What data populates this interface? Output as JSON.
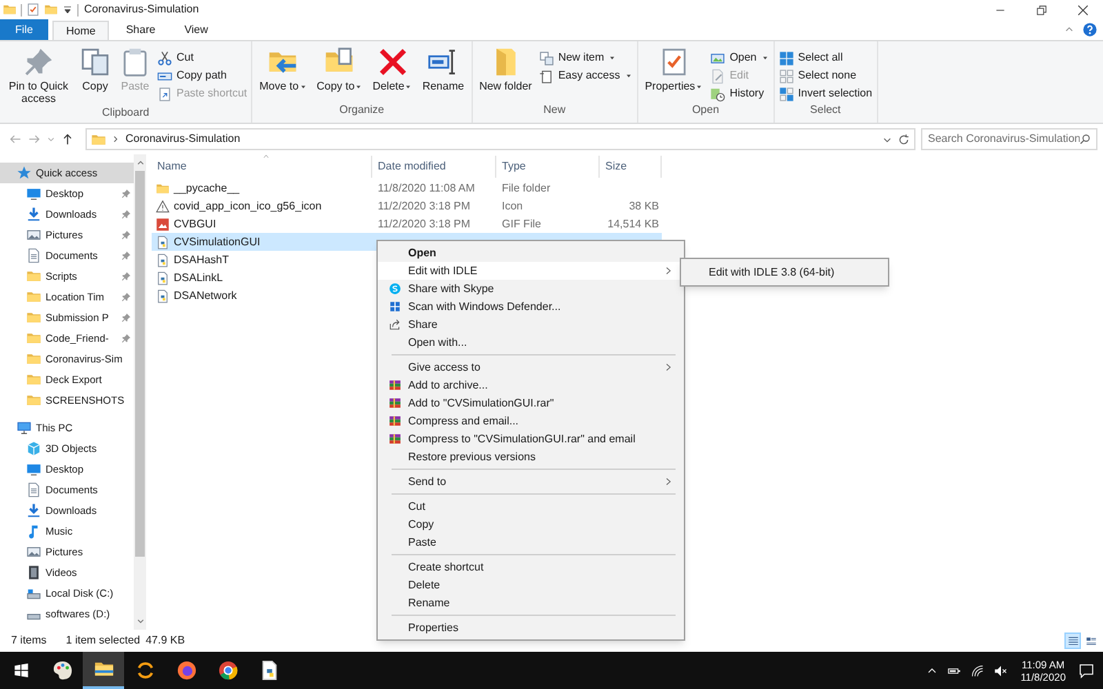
{
  "window": {
    "title": "Coronavirus-Simulation"
  },
  "tabs": [
    {
      "label": "File",
      "kind": "file",
      "selected": false
    },
    {
      "label": "Home",
      "kind": "tab",
      "selected": true
    },
    {
      "label": "Share",
      "kind": "tab",
      "selected": false
    },
    {
      "label": "View",
      "kind": "tab",
      "selected": false
    }
  ],
  "ribbon": {
    "groups": [
      {
        "label": "Clipboard",
        "items": [
          {
            "kind": "large",
            "label": "Pin to Quick access",
            "dropdown": false,
            "disabled": false
          },
          {
            "kind": "large",
            "label": "Copy",
            "dropdown": false,
            "disabled": false
          },
          {
            "kind": "large",
            "label": "Paste",
            "dropdown": false,
            "disabled": true
          },
          {
            "kind": "small",
            "label": "Cut",
            "dropdown": false,
            "disabled": false
          },
          {
            "kind": "small",
            "label": "Copy path",
            "dropdown": false,
            "disabled": false
          },
          {
            "kind": "small",
            "label": "Paste shortcut",
            "dropdown": false,
            "disabled": true
          }
        ]
      },
      {
        "label": "Organize",
        "items": [
          {
            "kind": "large",
            "label": "Move to",
            "dropdown": true,
            "disabled": false
          },
          {
            "kind": "large",
            "label": "Copy to",
            "dropdown": true,
            "disabled": false
          },
          {
            "kind": "large",
            "label": "Delete",
            "dropdown": true,
            "disabled": false
          },
          {
            "kind": "large",
            "label": "Rename",
            "dropdown": false,
            "disabled": false
          }
        ]
      },
      {
        "label": "New",
        "items": [
          {
            "kind": "large",
            "label": "New folder",
            "dropdown": false,
            "disabled": false
          },
          {
            "kind": "small",
            "label": "New item",
            "dropdown": true,
            "disabled": false
          },
          {
            "kind": "small",
            "label": "Easy access",
            "dropdown": true,
            "disabled": false
          }
        ]
      },
      {
        "label": "Open",
        "items": [
          {
            "kind": "large",
            "label": "Properties",
            "dropdown": true,
            "disabled": false
          },
          {
            "kind": "small",
            "label": "Open",
            "dropdown": true,
            "disabled": false
          },
          {
            "kind": "small",
            "label": "Edit",
            "dropdown": false,
            "disabled": true
          },
          {
            "kind": "small",
            "label": "History",
            "dropdown": false,
            "disabled": false
          }
        ]
      },
      {
        "label": "Select",
        "items": [
          {
            "kind": "small",
            "label": "Select all",
            "dropdown": false,
            "disabled": false
          },
          {
            "kind": "small",
            "label": "Select none",
            "dropdown": false,
            "disabled": false
          },
          {
            "kind": "small",
            "label": "Invert selection",
            "dropdown": false,
            "disabled": false
          }
        ]
      }
    ]
  },
  "address": {
    "crumb": "Coronavirus-Simulation"
  },
  "search": {
    "placeholder": "Search Coronavirus-Simulation"
  },
  "sidebar": {
    "items": [
      {
        "label": "Quick access",
        "selected": true,
        "children": [
          {
            "label": "Desktop",
            "pinned": true,
            "selected": false
          },
          {
            "label": "Downloads",
            "pinned": true,
            "selected": false
          },
          {
            "label": "Pictures",
            "pinned": true,
            "selected": false
          },
          {
            "label": "Documents",
            "pinned": true,
            "selected": false
          },
          {
            "label": "Scripts",
            "pinned": true,
            "selected": false
          },
          {
            "label": "Location Tim",
            "pinned": true,
            "selected": false
          },
          {
            "label": "Submission P",
            "pinned": true,
            "selected": false
          },
          {
            "label": "Code_Friend-",
            "pinned": true,
            "selected": false
          },
          {
            "label": "Coronavirus-Sim",
            "pinned": false,
            "selected": false
          },
          {
            "label": "Deck Export",
            "pinned": false,
            "selected": false
          },
          {
            "label": "SCREENSHOTS",
            "pinned": false,
            "selected": false
          }
        ]
      },
      {
        "label": "This PC",
        "selected": false,
        "children": [
          {
            "label": "3D Objects",
            "selected": false
          },
          {
            "label": "Desktop",
            "selected": false
          },
          {
            "label": "Documents",
            "selected": false
          },
          {
            "label": "Downloads",
            "selected": false
          },
          {
            "label": "Music",
            "selected": false
          },
          {
            "label": "Pictures",
            "selected": false
          },
          {
            "label": "Videos",
            "selected": false
          },
          {
            "label": "Local Disk (C:)",
            "selected": false
          },
          {
            "label": "softwares (D:)",
            "selected": false
          }
        ]
      }
    ]
  },
  "file_list": {
    "columns": [
      "Name",
      "Date modified",
      "Type",
      "Size"
    ],
    "rows": [
      {
        "name": "__pycache__",
        "date": "11/8/2020 11:08 AM",
        "type": "File folder",
        "selected": false
      },
      {
        "name": "covid_app_icon_ico_g56_icon",
        "date": "11/2/2020 3:18 PM",
        "type": "Icon",
        "size": "38 KB",
        "selected": false
      },
      {
        "name": "CVBGUI",
        "date": "11/2/2020 3:18 PM",
        "type": "GIF File",
        "size": "14,514 KB",
        "selected": false
      },
      {
        "name": "CVSimulationGUI",
        "selected": true
      },
      {
        "name": "DSAHashT",
        "selected": false
      },
      {
        "name": "DSALinkL",
        "selected": false
      },
      {
        "name": "DSANetwork",
        "selected": false
      }
    ]
  },
  "context_menu": {
    "items": [
      {
        "kind": "item",
        "label": "Open",
        "default": true,
        "submenu": false,
        "selected": false
      },
      {
        "kind": "item",
        "label": "Edit with IDLE",
        "default": false,
        "submenu": true,
        "selected": true
      },
      {
        "kind": "item",
        "label": "Share with Skype",
        "default": false,
        "submenu": false,
        "selected": false
      },
      {
        "kind": "item",
        "label": "Scan with Windows Defender...",
        "default": false,
        "submenu": false,
        "selected": false
      },
      {
        "kind": "item",
        "label": "Share",
        "default": false,
        "submenu": false,
        "selected": false
      },
      {
        "kind": "item",
        "label": "Open with...",
        "default": false,
        "submenu": false,
        "selected": false
      },
      {
        "kind": "separator"
      },
      {
        "kind": "item",
        "label": "Give access to",
        "default": false,
        "submenu": true,
        "selected": false
      },
      {
        "kind": "item",
        "label": "Add to archive...",
        "default": false,
        "submenu": false,
        "selected": false
      },
      {
        "kind": "item",
        "label": "Add to \"CVSimulationGUI.rar\"",
        "default": false,
        "submenu": false,
        "selected": false
      },
      {
        "kind": "item",
        "label": "Compress and email...",
        "default": false,
        "submenu": false,
        "selected": false
      },
      {
        "kind": "item",
        "label": "Compress to \"CVSimulationGUI.rar\" and email",
        "default": false,
        "submenu": false,
        "selected": false
      },
      {
        "kind": "item",
        "label": "Restore previous versions",
        "default": false,
        "submenu": false,
        "selected": false
      },
      {
        "kind": "separator"
      },
      {
        "kind": "item",
        "label": "Send to",
        "default": false,
        "submenu": true,
        "selected": false
      },
      {
        "kind": "separator"
      },
      {
        "kind": "item",
        "label": "Cut",
        "default": false,
        "submenu": false,
        "selected": false
      },
      {
        "kind": "item",
        "label": "Copy",
        "default": false,
        "submenu": false,
        "selected": false
      },
      {
        "kind": "item",
        "label": "Paste",
        "default": false,
        "submenu": false,
        "selected": false
      },
      {
        "kind": "separator"
      },
      {
        "kind": "item",
        "label": "Create shortcut",
        "default": false,
        "submenu": false,
        "selected": false
      },
      {
        "kind": "item",
        "label": "Delete",
        "default": false,
        "submenu": false,
        "selected": false
      },
      {
        "kind": "item",
        "label": "Rename",
        "default": false,
        "submenu": false,
        "selected": false
      },
      {
        "kind": "separator"
      },
      {
        "kind": "item",
        "label": "Properties",
        "default": false,
        "submenu": false,
        "selected": false
      }
    ]
  },
  "submenu": {
    "items": [
      {
        "label": "Edit with IDLE 3.8 (64-bit)"
      }
    ]
  },
  "status_bar": {
    "count": "7 items",
    "selection": "1 item selected",
    "size": "47.9 KB",
    "views": [
      {
        "kind": "details",
        "selected": true
      },
      {
        "kind": "tiles",
        "selected": false
      }
    ]
  },
  "taskbar": {
    "apps": [
      {
        "active": false
      },
      {
        "active": true
      },
      {
        "active": false
      },
      {
        "active": false
      },
      {
        "active": false
      },
      {
        "active": false
      }
    ],
    "time": "11:09 AM",
    "date": "11/8/2020"
  }
}
